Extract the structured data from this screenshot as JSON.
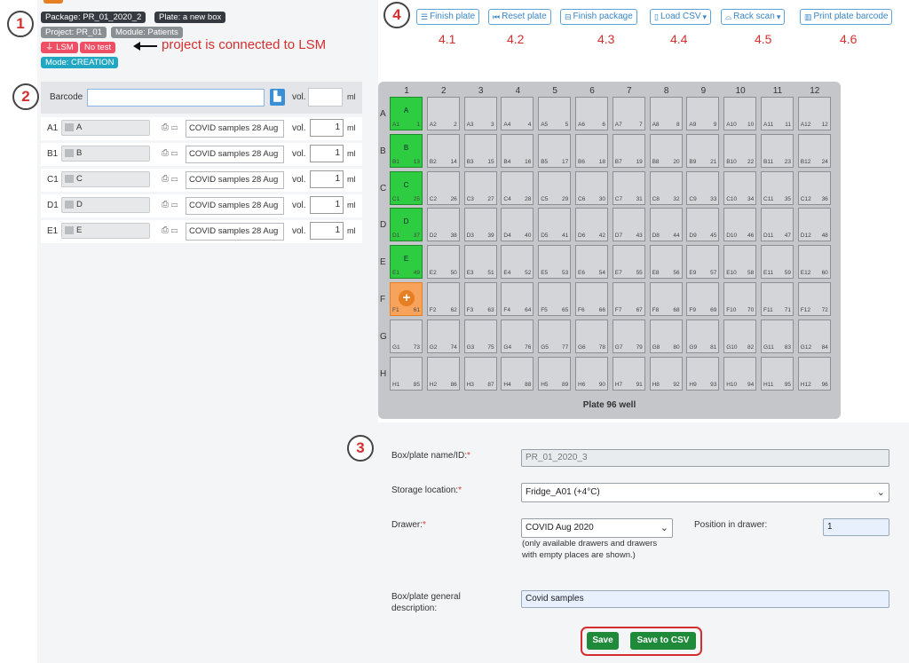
{
  "annotations": {
    "c1": "1",
    "c2": "2",
    "c3": "3",
    "c4": "4",
    "lsm_note": "project is connected to LSM",
    "sub": [
      "4.1",
      "4.2",
      "4.3",
      "4.4",
      "4.5",
      "4.6"
    ]
  },
  "badges": {
    "package": "Package: PR_01_2020_2",
    "plate": "Plate: a new box",
    "project": "Project: PR_01",
    "module": "Module: Patients",
    "lsm": "LSM",
    "no_test": "No test",
    "mode": "Mode: CREATION"
  },
  "toolbar": {
    "finish_plate": "Finish plate",
    "reset_plate": "Reset plate",
    "finish_package": "Finish package",
    "load_csv": "Load CSV",
    "rack_scan": "Rack scan",
    "print_barcode": "Print plate barcode"
  },
  "barcode_bar": {
    "label": "Barcode",
    "value": "",
    "vol_label": "vol.",
    "vol_value": "",
    "unit": "ml"
  },
  "samples": [
    {
      "pos": "A1",
      "barcode": "A",
      "description": "COVID samples 28 Aug",
      "vol_label": "vol.",
      "vol": "1",
      "unit": "ml"
    },
    {
      "pos": "B1",
      "barcode": "B",
      "description": "COVID samples 28 Aug",
      "vol_label": "vol.",
      "vol": "1",
      "unit": "ml"
    },
    {
      "pos": "C1",
      "barcode": "C",
      "description": "COVID samples 28 Aug",
      "vol_label": "vol.",
      "vol": "1",
      "unit": "ml"
    },
    {
      "pos": "D1",
      "barcode": "D",
      "description": "COVID samples 28 Aug",
      "vol_label": "vol.",
      "vol": "1",
      "unit": "ml"
    },
    {
      "pos": "E1",
      "barcode": "E",
      "description": "COVID samples 28 Aug",
      "vol_label": "vol.",
      "vol": "1",
      "unit": "ml"
    }
  ],
  "plate": {
    "title": "Plate 96 well",
    "columns": [
      "1",
      "2",
      "3",
      "4",
      "5",
      "6",
      "7",
      "8",
      "9",
      "10",
      "11",
      "12"
    ],
    "rows": [
      "A",
      "B",
      "C",
      "D",
      "E",
      "F",
      "G",
      "H"
    ],
    "filled": {
      "A1": "A",
      "B1": "B",
      "C1": "C",
      "D1": "D",
      "E1": "E"
    },
    "active": "F1",
    "colors": {
      "filled": "#2ecc40",
      "active": "#f7a35c",
      "empty": "#d3d5d8"
    }
  },
  "form": {
    "name_label": "Box/plate name/ID:",
    "name_value": "PR_01_2020_3",
    "storage_label": "Storage location:",
    "storage_value": "Fridge_A01 (+4°C)",
    "drawer_label": "Drawer:",
    "drawer_value": "COVID Aug 2020",
    "drawer_help": "(only available drawers and drawers with empty places are shown.)",
    "position_label": "Position in drawer:",
    "position_value": "1",
    "description_label": "Box/plate general description:",
    "description_value": "Covid samples",
    "required_mark": "*",
    "save": "Save",
    "save_csv": "Save to CSV"
  }
}
